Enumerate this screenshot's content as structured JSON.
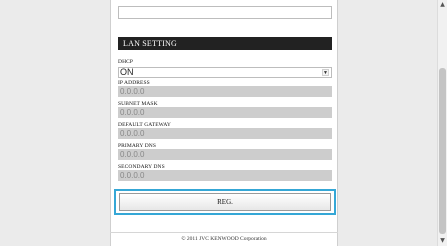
{
  "lan_section": {
    "title": "LAN SETTING",
    "dhcp": {
      "label": "DHCP",
      "value": "ON"
    },
    "ip_address": {
      "label": "IP ADDRESS",
      "value": "0.0.0.0"
    },
    "subnet_mask": {
      "label": "SUBNET MASK",
      "value": "0.0.0.0"
    },
    "default_gateway": {
      "label": "DEFAULT GATEWAY",
      "value": "0.0.0.0"
    },
    "primary_dns": {
      "label": "PRIMARY DNS",
      "value": "0.0.0.0"
    },
    "secondary_dns": {
      "label": "SECONDARY DNS",
      "value": "0.0.0.0"
    }
  },
  "reg_button": {
    "label": "REG."
  },
  "footer": {
    "copyright": "© 2011 JVC KENWOOD Corporation"
  },
  "icons": {
    "dropdown": "chevron-down-icon",
    "scroll_up": "arrow-up-icon",
    "scroll_down": "arrow-down-icon"
  },
  "colors": {
    "header_bg": "#222222",
    "focus_ring": "#35a7d6",
    "disabled_field": "#cdcdcd"
  }
}
